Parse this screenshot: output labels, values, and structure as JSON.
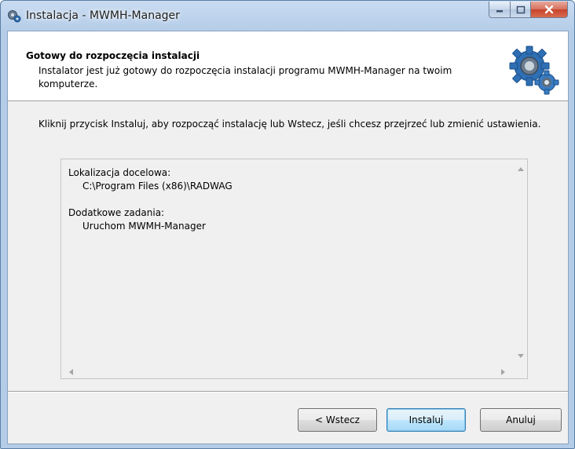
{
  "window": {
    "title": "Instalacja - MWMH-Manager",
    "icon": "gear-installer-icon"
  },
  "caption_buttons": {
    "minimize_icon": "minimize-icon",
    "maximize_icon": "maximize-icon",
    "close_icon": "close-icon"
  },
  "header": {
    "title": "Gotowy do rozpoczęcia instalacji",
    "description": "Instalator jest już gotowy do rozpoczęcia instalacji programu MWMH-Manager na twoim komputerze.",
    "image_icon": "gears-icon"
  },
  "body": {
    "intro": "Kliknij przycisk Instaluj, aby rozpocząć instalację lub Wstecz, jeśli chcesz przejrzeć lub zmienić ustawienia."
  },
  "memo": {
    "lines": [
      {
        "label": "Lokalizacja docelowa:",
        "value": "C:\\Program Files (x86)\\RADWAG"
      },
      {
        "label": "Dodatkowe zadania:",
        "value": "Uruchom MWMH-Manager"
      }
    ]
  },
  "buttons": {
    "back": "< Wstecz",
    "install": "Instaluj",
    "cancel": "Anuluj"
  },
  "colors": {
    "titlebar": "#bcd2ec",
    "client_bg": "#f0f0f0",
    "header_bg": "#ffffff",
    "close_button": "#c7432b",
    "gear_blue": "#2f6fb4"
  }
}
